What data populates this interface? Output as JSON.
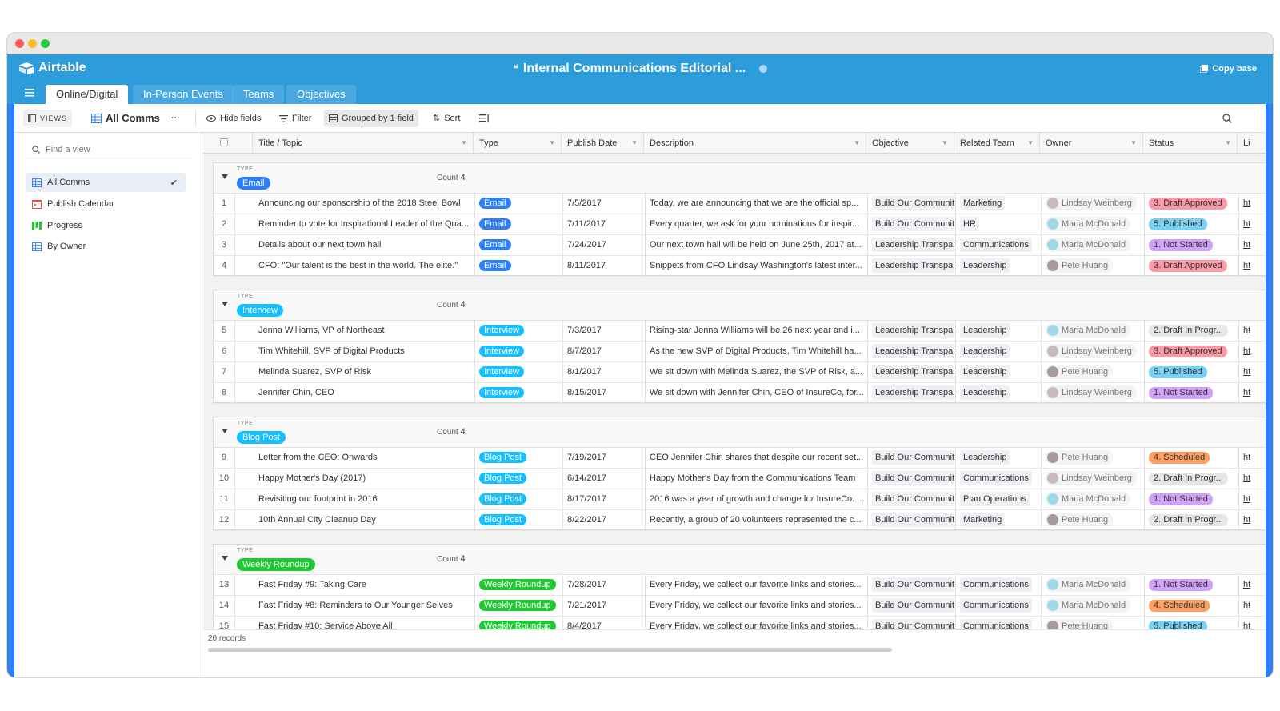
{
  "app": {
    "brand": "Airtable",
    "base_title": "Internal Communications Editorial ...",
    "copy_base": "Copy base"
  },
  "tabs": [
    {
      "label": "Online/Digital",
      "active": true
    },
    {
      "label": "In-Person Events",
      "active": false
    },
    {
      "label": "Teams",
      "active": false
    },
    {
      "label": "Objectives",
      "active": false
    }
  ],
  "toolbar": {
    "views_label": "VIEWS",
    "current_view": "All Comms",
    "more": "···",
    "hide_fields": "Hide fields",
    "filter": "Filter",
    "grouped": "Grouped by 1 field",
    "sort": "Sort"
  },
  "sidebar": {
    "find_placeholder": "Find a view",
    "views": [
      {
        "label": "All Comms",
        "icon": "grid-icon",
        "active": true
      },
      {
        "label": "Publish Calendar",
        "icon": "calendar-icon",
        "active": false
      },
      {
        "label": "Progress",
        "icon": "kanban-icon",
        "active": false
      },
      {
        "label": "By Owner",
        "icon": "grid-icon",
        "active": false
      }
    ]
  },
  "columns": [
    "Title / Topic",
    "Type",
    "Publish Date",
    "Description",
    "Objective",
    "Related Team",
    "Owner",
    "Status",
    "Li"
  ],
  "colors": {
    "Email": "#2d7ff9",
    "Interview": "#18bfff",
    "Blog Post": "#18bfff",
    "Weekly Roundup": "#20c933",
    "status": {
      "1. Not Started": "#d0a2f7",
      "2. Draft In Progr...": "#e6e6e6",
      "3. Draft Approved": "#f99aa6",
      "4. Scheduled": "#ff9f63",
      "5. Published": "#77d1f3"
    },
    "owners": {
      "Lindsay Weinberg": "#c9b8c0",
      "Maria McDonald": "#9fd8e6",
      "Pete Huang": "#a89b9b"
    }
  },
  "group_label": "TYPE",
  "count_label": "Count",
  "groups": [
    {
      "name": "Email",
      "count": "4",
      "rows": [
        {
          "n": "1",
          "title": "Announcing our sponsorship of the 2018 Steel Bowl",
          "type": "Email",
          "date": "7/5/2017",
          "desc": "Today, we are announcing that we are the official sp...",
          "objective": "Build Our Communit",
          "team": "Marketing",
          "owner": "Lindsay Weinberg",
          "status": "3. Draft Approved",
          "link": "ht"
        },
        {
          "n": "2",
          "title": "Reminder to vote for Inspirational Leader of the Qua...",
          "type": "Email",
          "date": "7/11/2017",
          "desc": "Every quarter, we ask for your nominations for inspir...",
          "objective": "Build Our Communit",
          "team": "HR",
          "owner": "Maria McDonald",
          "status": "5. Published",
          "link": "ht"
        },
        {
          "n": "3",
          "title": "Details about our next town hall",
          "type": "Email",
          "date": "7/24/2017",
          "desc": "Our next town hall will be held on June 25th, 2017 at...",
          "objective": "Leadership Transpar",
          "team": "Communications",
          "owner": "Maria McDonald",
          "status": "1. Not Started",
          "link": "ht"
        },
        {
          "n": "4",
          "title": "CFO: \"Our talent is the best in the world. The elite.\"",
          "type": "Email",
          "date": "8/11/2017",
          "desc": "Snippets from CFO Lindsay Washington's latest inter...",
          "objective": "Leadership Transpar",
          "team": "Leadership",
          "owner": "Pete Huang",
          "status": "3. Draft Approved",
          "link": "ht"
        }
      ]
    },
    {
      "name": "Interview",
      "count": "4",
      "rows": [
        {
          "n": "5",
          "title": "Jenna Williams, VP of Northeast",
          "type": "Interview",
          "date": "7/3/2017",
          "desc": "Rising-star Jenna Williams will be 26 next year and i...",
          "objective": "Leadership Transpar",
          "team": "Leadership",
          "owner": "Maria McDonald",
          "status": "2. Draft In Progr...",
          "link": "ht"
        },
        {
          "n": "6",
          "title": "Tim Whitehill, SVP of Digital Products",
          "type": "Interview",
          "date": "8/7/2017",
          "desc": "As the new SVP of Digital Products, Tim Whitehill ha...",
          "objective": "Leadership Transpar",
          "team": "Leadership",
          "owner": "Lindsay Weinberg",
          "status": "3. Draft Approved",
          "link": "ht"
        },
        {
          "n": "7",
          "title": "Melinda Suarez, SVP of Risk",
          "type": "Interview",
          "date": "8/1/2017",
          "desc": "We sit down with Melinda Suarez, the SVP of Risk, a...",
          "objective": "Leadership Transpar",
          "team": "Leadership",
          "owner": "Pete Huang",
          "status": "5. Published",
          "link": "ht"
        },
        {
          "n": "8",
          "title": "Jennifer Chin, CEO",
          "type": "Interview",
          "date": "8/15/2017",
          "desc": "We sit down with Jennifer Chin, CEO of InsureCo, for...",
          "objective": "Leadership Transpar",
          "team": "Leadership",
          "owner": "Lindsay Weinberg",
          "status": "1. Not Started",
          "link": "ht"
        }
      ]
    },
    {
      "name": "Blog Post",
      "count": "4",
      "rows": [
        {
          "n": "9",
          "title": "Letter from the CEO: Onwards",
          "type": "Blog Post",
          "date": "7/19/2017",
          "desc": "CEO Jennifer Chin shares that despite our recent set...",
          "objective": "Build Our Communit",
          "team": "Leadership",
          "owner": "Pete Huang",
          "status": "4. Scheduled",
          "link": "ht"
        },
        {
          "n": "10",
          "title": "Happy Mother's Day (2017)",
          "type": "Blog Post",
          "date": "6/14/2017",
          "desc": "Happy Mother's Day from the Communications Team",
          "objective": "Build Our Communit",
          "team": "Communications",
          "owner": "Lindsay Weinberg",
          "status": "2. Draft In Progr...",
          "link": "ht"
        },
        {
          "n": "11",
          "title": "Revisiting our footprint in 2016",
          "type": "Blog Post",
          "date": "8/17/2017",
          "desc": "2016 was a year of growth and change for InsureCo. ...",
          "objective": "Build Our Communit",
          "team": "Plan Operations",
          "owner": "Maria McDonald",
          "status": "1. Not Started",
          "link": "ht"
        },
        {
          "n": "12",
          "title": "10th Annual City Cleanup Day",
          "type": "Blog Post",
          "date": "8/22/2017",
          "desc": "Recently, a group of 20 volunteers represented the c...",
          "objective": "Build Our Communit",
          "team": "Marketing",
          "owner": "Pete Huang",
          "status": "2. Draft In Progr...",
          "link": "ht"
        }
      ]
    },
    {
      "name": "Weekly Roundup",
      "count": "4",
      "rows": [
        {
          "n": "13",
          "title": "Fast Friday #9: Taking Care",
          "type": "Weekly Roundup",
          "date": "7/28/2017",
          "desc": "Every Friday, we collect our favorite links and stories...",
          "objective": "Build Our Communit",
          "team": "Communications",
          "owner": "Maria McDonald",
          "status": "1. Not Started",
          "link": "ht"
        },
        {
          "n": "14",
          "title": "Fast Friday #8: Reminders to Our Younger Selves",
          "type": "Weekly Roundup",
          "date": "7/21/2017",
          "desc": "Every Friday, we collect our favorite links and stories...",
          "objective": "Build Our Communit",
          "team": "Communications",
          "owner": "Maria McDonald",
          "status": "4. Scheduled",
          "link": "ht"
        },
        {
          "n": "15",
          "title": "Fast Friday #10: Service Above All",
          "type": "Weekly Roundup",
          "date": "8/4/2017",
          "desc": "Every Friday, we collect our favorite links and stories...",
          "objective": "Build Our Communit",
          "team": "Communications",
          "owner": "Pete Huang",
          "status": "5. Published",
          "link": "ht"
        }
      ]
    }
  ],
  "footer": {
    "records": "20 records"
  }
}
